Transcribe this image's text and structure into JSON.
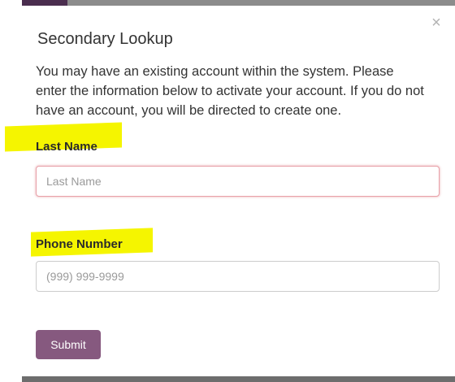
{
  "modal": {
    "close_symbol": "×",
    "title": "Secondary Lookup",
    "description": "You may have an existing account within the system. Please enter the information below to activate your account. If you do not have an account, you will be directed to create one."
  },
  "form": {
    "last_name": {
      "label": "Last Name",
      "value": "",
      "placeholder": "Last Name"
    },
    "phone": {
      "label": "Phone Number",
      "value": "",
      "placeholder": "(999) 999-9999"
    },
    "submit_label": "Submit"
  },
  "colors": {
    "accent": "#86597f",
    "highlighter": "#f5f500",
    "error_border": "#e8a0a8"
  }
}
